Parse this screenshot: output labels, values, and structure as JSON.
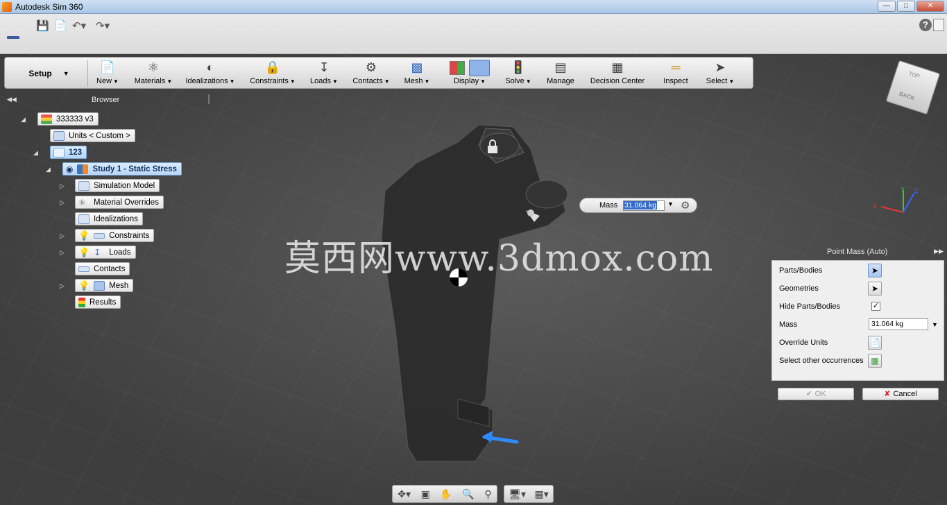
{
  "window": {
    "title": "Autodesk Sim 360",
    "min": "0",
    "max": "1",
    "close": "r"
  },
  "toolbar": {
    "workspace": "Setup",
    "items": [
      {
        "label": "New",
        "icon": "new-icon",
        "dropdown": true
      },
      {
        "label": "Materials",
        "icon": "materials-icon",
        "dropdown": true
      },
      {
        "label": "Idealizations",
        "icon": "idealizations-icon",
        "dropdown": true
      },
      {
        "label": "Constraints",
        "icon": "constraints-icon",
        "dropdown": true
      },
      {
        "label": "Loads",
        "icon": "loads-icon",
        "dropdown": true
      },
      {
        "label": "Contacts",
        "icon": "contacts-icon",
        "dropdown": true
      },
      {
        "label": "Mesh",
        "icon": "mesh-icon",
        "dropdown": true
      },
      {
        "label": "Display",
        "icon": "display-icon",
        "dropdown": true
      },
      {
        "label": "Solve",
        "icon": "solve-icon",
        "dropdown": true
      },
      {
        "label": "Manage",
        "icon": "manage-icon",
        "dropdown": false
      },
      {
        "label": "Decision Center",
        "icon": "decision-center-icon",
        "dropdown": false
      },
      {
        "label": "Inspect",
        "icon": "inspect-icon",
        "dropdown": false
      },
      {
        "label": "Select",
        "icon": "select-icon",
        "dropdown": true
      }
    ]
  },
  "browser": {
    "title": "Browser",
    "nodes": {
      "root": "333333 v3",
      "units": "Units < Custom >",
      "part": "123",
      "study": "Study 1 - Static Stress",
      "simulation_model": "Simulation Model",
      "material_overrides": "Material Overrides",
      "idealizations": "Idealizations",
      "constraints": "Constraints",
      "loads": "Loads",
      "contacts": "Contacts",
      "mesh": "Mesh",
      "results": "Results"
    }
  },
  "watermark": "莫西网www.3dmox.com",
  "mass_popup": {
    "label": "Mass",
    "value": "31.064 kg"
  },
  "viewcube": {
    "top": "TOP",
    "back": "BACK"
  },
  "point_mass": {
    "title": "Point Mass (Auto)",
    "rows": {
      "parts_bodies": "Parts/Bodies",
      "geometries": "Geometries",
      "hide_parts": "Hide Parts/Bodies",
      "mass": "Mass",
      "override_units": "Override Units",
      "select_other": "Select other occurrences"
    },
    "mass_value": "31.064 kg",
    "hide_parts_checked": true,
    "ok_label": "OK",
    "cancel_label": "Cancel"
  },
  "triad": {
    "x": "X",
    "y": "Y",
    "z": "Z"
  }
}
